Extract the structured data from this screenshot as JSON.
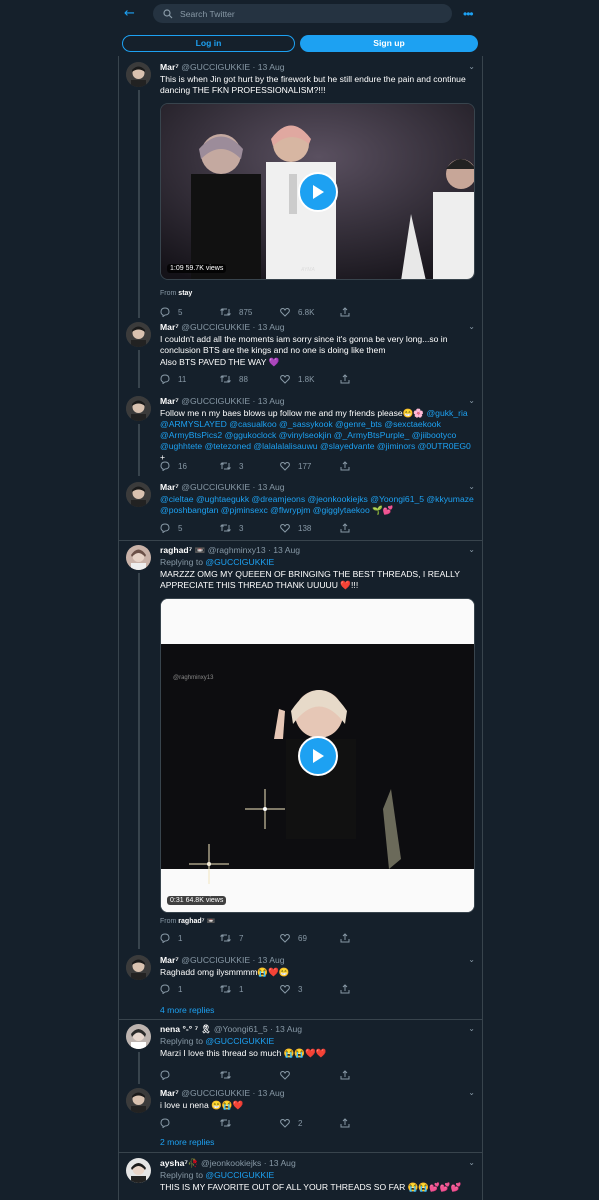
{
  "header": {
    "search_placeholder": "Search Twitter",
    "login_label": "Log in",
    "signup_label": "Sign up",
    "back_icon": "←",
    "more_icon": "•••"
  },
  "tweets": [
    {
      "name": "Mar⁷",
      "handle": "@GUCCIGUKKIE · 13 Aug",
      "text": "This is when Jin got hurt by the firework but he still endure the pain and continue dancing THE FKN PROFESSIONALISM?!!!",
      "video_time": "1:09",
      "video_views": "59.7K views",
      "video_watermark": "AYMA",
      "from_label": "From",
      "from_source": "stay",
      "replies": "5",
      "retweets": "875",
      "likes": "6.8K"
    },
    {
      "name": "Mar⁷",
      "handle": "@GUCCIGUKKIE · 13 Aug",
      "text": "I couldn't add all the moments iam sorry since it's gonna be very long...so in conclusion BTS are the kings and no one is doing like them",
      "text2": "Also BTS PAVED THE WAY 💜",
      "replies": "11",
      "retweets": "88",
      "likes": "1.8K"
    },
    {
      "name": "Mar⁷",
      "handle": "@GUCCIGUKKIE · 13 Aug",
      "text": "Follow me n my baes blows up follow me and my friends please😁🌸",
      "mentions1": "@gukk_ria",
      "mentions2": "@ARMYSLAYED @casualkoo @_sassykook @genre_bts @sexctaekook @ArmyBtsPics2 @ggukoclock @vinylseokjin @_ArmyBtsPurple_ @jiibootyco @ughhtete @tetezoned @lalalalalisauwu @slayedvante @jiminors @0UTR0EG0",
      "plus": " +",
      "replies": "16",
      "retweets": "3",
      "likes": "177"
    },
    {
      "name": "Mar⁷",
      "handle": "@GUCCIGUKKIE · 13 Aug",
      "mentions": "@cieltae @ughtaegukk @dreamjeons @jeonkookiejks @Yoongi61_5 @kkyumaze @poshbangtan @pjminsexc @flwrypjm @gigglytaekoo",
      "emoji": "🌱💕",
      "replies": "5",
      "retweets": "3",
      "likes": "138"
    },
    {
      "name": "raghad⁷ 📼",
      "handle": "@raghminxy13 · 13 Aug",
      "replying_label": "Replying to",
      "replying_to": "@GUCCIGUKKIE",
      "text": "MARZZZ OMG MY QUEEEN OF BRINGING THE BEST THREADS, I REALLY APPRECIATE THIS THREAD THANK UUUUU ❤️!!!",
      "video_watermark": "@raghminxy13",
      "video_time": "0:31",
      "video_views": "64.8K views",
      "from_label": "From",
      "from_source": "raghad⁷ 📼",
      "replies": "1",
      "retweets": "7",
      "likes": "69"
    },
    {
      "name": "Mar⁷",
      "handle": "@GUCCIGUKKIE · 13 Aug",
      "text": "Raghadd omg ilysmmmm😭❤️😁",
      "replies": "1",
      "retweets": "1",
      "likes": "3"
    },
    {
      "name": "nena °-° ⁷ 🎗",
      "handle": "@Yoongi61_5 · 13 Aug",
      "replying_label": "Replying to",
      "replying_to": "@GUCCIGUKKIE",
      "text": "Marzi I love this thread so much 😭😭❤️❤️",
      "replies": "",
      "retweets": "",
      "likes": ""
    },
    {
      "name": "Mar⁷",
      "handle": "@GUCCIGUKKIE · 13 Aug",
      "text": "i love u nena 😁😭❤️",
      "replies": "",
      "retweets": "",
      "likes": "2"
    },
    {
      "name": "aysha⁷🥀",
      "handle": "@jeonkookiejks · 13 Aug",
      "replying_label": "Replying to",
      "replying_to": "@GUCCIGUKKIE",
      "text": "THIS IS MY FAVORITE OUT OF ALL YOUR THREADS SO FAR 😭😭💕💕💕"
    }
  ],
  "more_replies_1": "4 more replies",
  "more_replies_2": "2 more replies",
  "colors": {
    "background": "#15202b",
    "accent": "#1da1f2",
    "muted": "#8899a6",
    "border": "#38444d"
  }
}
